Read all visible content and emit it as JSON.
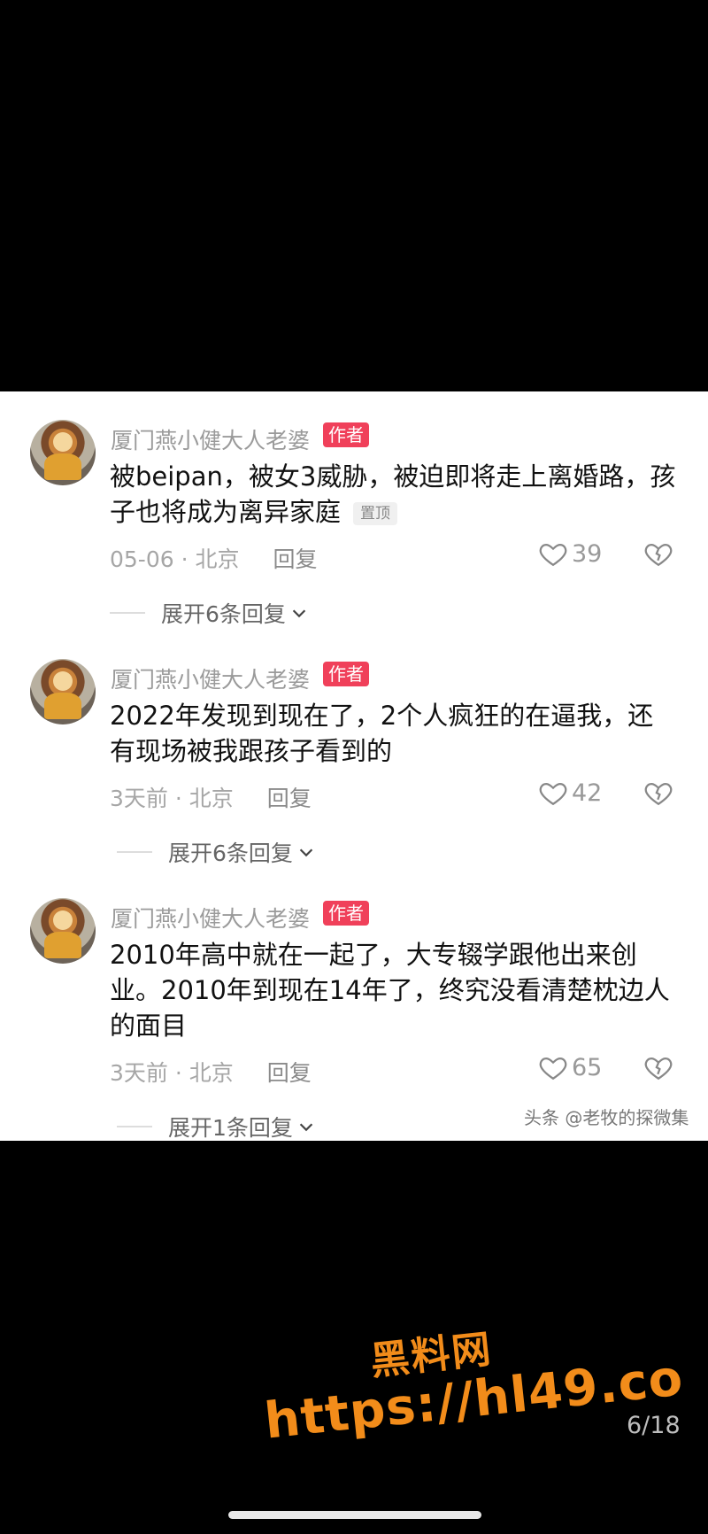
{
  "comments": [
    {
      "username": "厦门燕小健大人老婆",
      "badge": "作者",
      "text": "被beipan，被女3威胁，被迫即将走上离婚路，孩子也将成为离异家庭",
      "pin_label": "置顶",
      "time": "05-06",
      "location": "北京",
      "reply_label": "回复",
      "likes": "39",
      "expand_label": "展开6条回复"
    },
    {
      "username": "厦门燕小健大人老婆",
      "badge": "作者",
      "text": "2022年发现到现在了，2个人疯狂的在逼我，还有现场被我跟孩子看到的",
      "time": "3天前",
      "location": "北京",
      "reply_label": "回复",
      "likes": "42",
      "expand_label": "展开6条回复"
    },
    {
      "username": "厦门燕小健大人老婆",
      "badge": "作者",
      "text": "2010年高中就在一起了，大专辍学跟他出来创业。2010年到现在14年了，终究没看清楚枕边人的面目",
      "time": "3天前",
      "location": "北京",
      "reply_label": "回复",
      "likes": "65",
      "expand_label": "展开1条回复"
    }
  ],
  "watermark": "头条 @老牧的探微集",
  "promo": {
    "title": "黑料网",
    "url": "https://hl49.co"
  },
  "page_counter": "6/18",
  "colors": {
    "badge": "#f0405a",
    "promo": "#f28c1a",
    "background": "#000000",
    "panel": "#ffffff"
  }
}
